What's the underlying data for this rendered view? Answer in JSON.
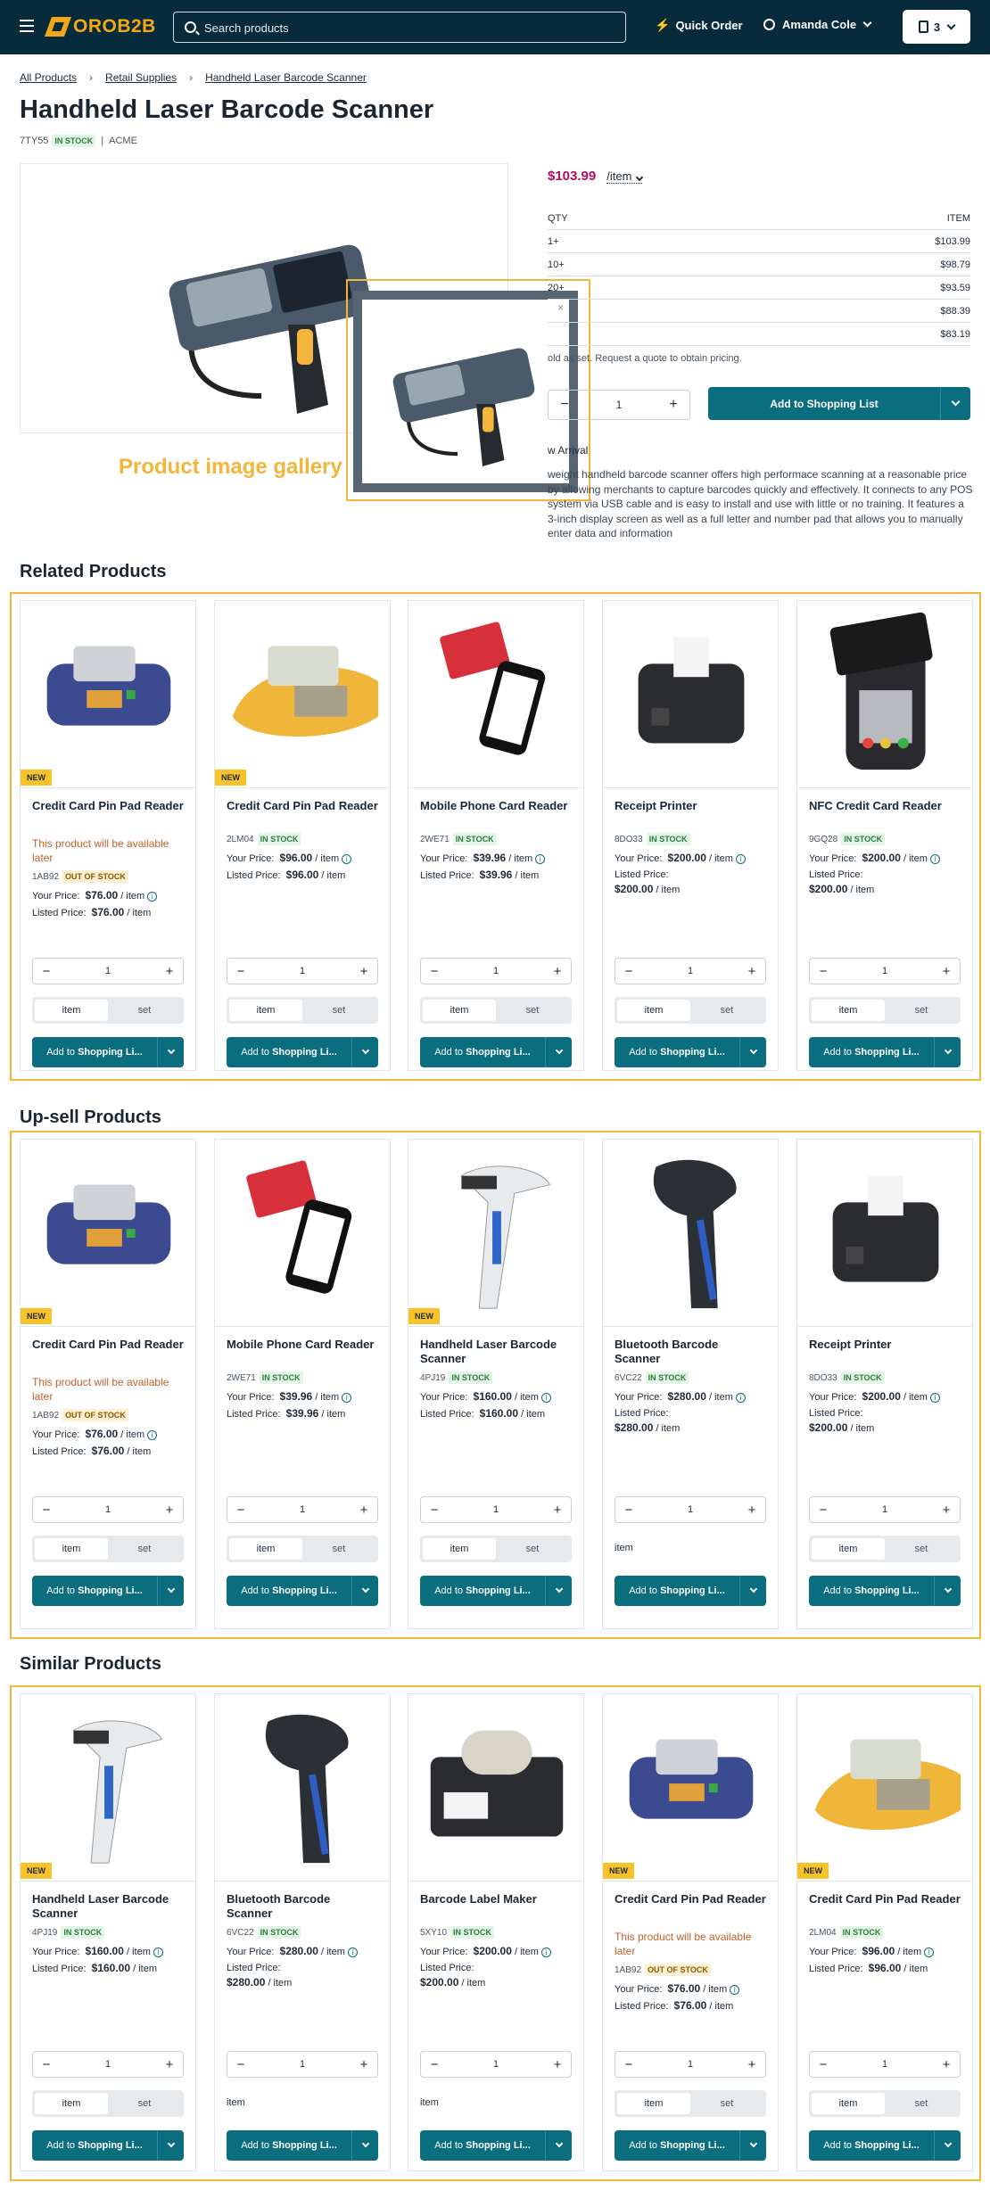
{
  "header": {
    "logo": "OROB2B",
    "search_placeholder": "Search products",
    "quick_order": "Quick Order",
    "user": "Amanda Cole",
    "cart_count": "3"
  },
  "breadcrumbs": [
    "All Products",
    "Retail Supplies",
    "Handheld Laser Barcode Scanner"
  ],
  "product": {
    "title": "Handheld Laser Barcode Scanner",
    "sku": "7TY55",
    "stock": "IN STOCK",
    "brand": "ACME",
    "price": "$103.99",
    "unit": "/item",
    "tiers_header": [
      "QTY",
      "ITEM"
    ],
    "tiers": [
      [
        "1+",
        "$103.99"
      ],
      [
        "10+",
        "$98.79"
      ],
      [
        "20+",
        "$93.59"
      ],
      [
        "",
        "$88.39"
      ],
      [
        "",
        "$83.19"
      ]
    ],
    "note": "old as set. Request a quote to obtain pricing.",
    "qty": "1",
    "add_label": "Add to Shopping List",
    "new_arrival": "w Arrival",
    "description": "weight handheld barcode scanner offers high performace scanning at a reasonable price by allowing merchants to capture barcodes quickly and effectively. It connects to any POS system via USB cable and is easy to install and use with little or no training. It features a 3-inch display screen as well as a full letter and number pad that allows you to manually enter data and information"
  },
  "gallery_label": "Product image gallery",
  "sections": [
    {
      "title": "Related Products",
      "cards": [
        {
          "img": "pinpad-blue",
          "new": true,
          "name": "Credit Card Pin Pad Reader",
          "avail": "This product will be available later",
          "sku": "1AB92",
          "stock": "OUT OF STOCK",
          "your": "$76.00",
          "listed": "$76.00",
          "units": true
        },
        {
          "img": "pinpad-yellow",
          "new": true,
          "name": "Credit Card Pin Pad Reader",
          "avail": "",
          "sku": "2LM04",
          "stock": "IN STOCK",
          "your": "$96.00",
          "listed": "$96.00",
          "units": true
        },
        {
          "img": "phone-card",
          "new": false,
          "name": "Mobile Phone Card Reader",
          "avail": "",
          "sku": "2WE71",
          "stock": "IN STOCK",
          "your": "$39.96",
          "listed": "$39.96",
          "units": true
        },
        {
          "img": "printer",
          "new": false,
          "name": "Receipt Printer",
          "avail": "",
          "sku": "8DO33",
          "stock": "IN STOCK",
          "your": "$200.00",
          "listed": "$200.00",
          "units": true
        },
        {
          "img": "nfc",
          "new": false,
          "name": "NFC Credit Card Reader",
          "avail": "",
          "sku": "9GQ28",
          "stock": "IN STOCK",
          "your": "$200.00",
          "listed": "$200.00",
          "units": true
        }
      ]
    },
    {
      "title": "Up-sell Products",
      "cards": [
        {
          "img": "pinpad-blue",
          "new": true,
          "name": "Credit Card Pin Pad Reader",
          "avail": "This product will be available later",
          "sku": "1AB92",
          "stock": "OUT OF STOCK",
          "your": "$76.00",
          "listed": "$76.00",
          "units": true
        },
        {
          "img": "phone-card",
          "new": false,
          "name": "Mobile Phone Card Reader",
          "avail": "",
          "sku": "2WE71",
          "stock": "IN STOCK",
          "your": "$39.96",
          "listed": "$39.96",
          "units": true
        },
        {
          "img": "scanner-white",
          "new": true,
          "name": "Handheld Laser Barcode Scanner",
          "avail": "",
          "sku": "4PJ19",
          "stock": "IN STOCK",
          "your": "$160.00",
          "listed": "$160.00",
          "units": true
        },
        {
          "img": "scanner-black",
          "new": false,
          "name": "Bluetooth Barcode Scanner",
          "avail": "",
          "sku": "6VC22",
          "stock": "IN STOCK",
          "your": "$280.00",
          "listed": "$280.00",
          "units": false
        },
        {
          "img": "printer",
          "new": false,
          "name": "Receipt Printer",
          "avail": "",
          "sku": "8DO33",
          "stock": "IN STOCK",
          "your": "$200.00",
          "listed": "$200.00",
          "units": true
        }
      ]
    },
    {
      "title": "Similar Products",
      "cards": [
        {
          "img": "scanner-white",
          "new": true,
          "name": "Handheld Laser Barcode Scanner",
          "avail": "",
          "sku": "4PJ19",
          "stock": "IN STOCK",
          "your": "$160.00",
          "listed": "$160.00",
          "units": true
        },
        {
          "img": "scanner-black",
          "new": false,
          "name": "Bluetooth Barcode Scanner",
          "avail": "",
          "sku": "6VC22",
          "stock": "IN STOCK",
          "your": "$280.00",
          "listed": "$280.00",
          "units": false
        },
        {
          "img": "label-maker",
          "new": false,
          "name": "Barcode Label Maker",
          "avail": "",
          "sku": "5XY10",
          "stock": "IN STOCK",
          "your": "$200.00",
          "listed": "$200.00",
          "units": false
        },
        {
          "img": "pinpad-blue",
          "new": true,
          "name": "Credit Card Pin Pad Reader",
          "avail": "This product will be available later",
          "sku": "1AB92",
          "stock": "OUT OF STOCK",
          "your": "$76.00",
          "listed": "$76.00",
          "units": true
        },
        {
          "img": "pinpad-yellow",
          "new": true,
          "name": "Credit Card Pin Pad Reader",
          "avail": "",
          "sku": "2LM04",
          "stock": "IN STOCK",
          "your": "$96.00",
          "listed": "$96.00",
          "units": true
        }
      ]
    }
  ],
  "labels": {
    "new": "NEW",
    "your_price": "Your Price:",
    "listed_price": "Listed Price:",
    "per_item": "/ item",
    "item": "item",
    "set": "set",
    "qty": "1",
    "add": "Add to Shopping Li...",
    "add_bold": "Shopping Li..."
  },
  "colors": {
    "header": "#082b3c",
    "accent": "#f3a813",
    "primary": "#0b6e7f",
    "price": "#b10b5f",
    "highlight": "#f3b53a"
  }
}
